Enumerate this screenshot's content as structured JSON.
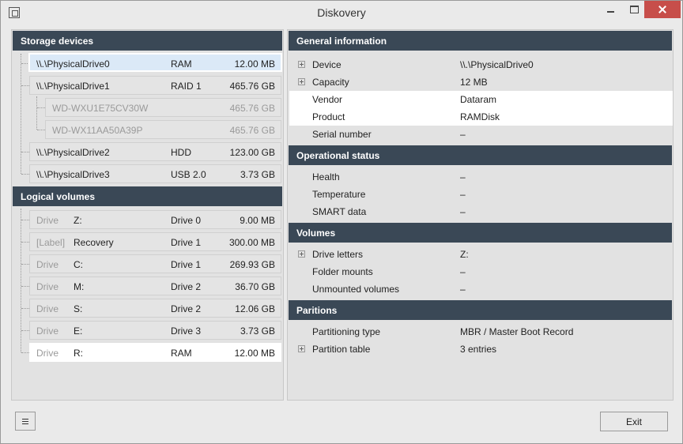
{
  "window": {
    "title": "Diskovery"
  },
  "storage": {
    "header": "Storage devices",
    "devices": [
      {
        "name": "\\\\.\\PhysicalDrive0",
        "type": "RAM",
        "size": "12.00 MB"
      },
      {
        "name": "\\\\.\\PhysicalDrive1",
        "type": "RAID 1",
        "size": "465.76 GB"
      },
      {
        "name": "WD-WXU1E75CV30W",
        "type": "",
        "size": "465.76 GB"
      },
      {
        "name": "WD-WX11AA50A39P",
        "type": "",
        "size": "465.76 GB"
      },
      {
        "name": "\\\\.\\PhysicalDrive2",
        "type": "HDD",
        "size": "123.00 GB"
      },
      {
        "name": "\\\\.\\PhysicalDrive3",
        "type": "USB 2.0",
        "size": "3.73 GB"
      }
    ]
  },
  "volumes": {
    "header": "Logical volumes",
    "items": [
      {
        "kind": "Drive",
        "name": "Z:",
        "drive": "Drive 0",
        "size": "9.00 MB"
      },
      {
        "kind": "[Label]",
        "name": "Recovery",
        "drive": "Drive 1",
        "size": "300.00 MB"
      },
      {
        "kind": "Drive",
        "name": "C:",
        "drive": "Drive 1",
        "size": "269.93 GB"
      },
      {
        "kind": "Drive",
        "name": "M:",
        "drive": "Drive 2",
        "size": "36.70 GB"
      },
      {
        "kind": "Drive",
        "name": "S:",
        "drive": "Drive 2",
        "size": "12.06 GB"
      },
      {
        "kind": "Drive",
        "name": "E:",
        "drive": "Drive 3",
        "size": "3.73 GB"
      },
      {
        "kind": "Drive",
        "name": "R:",
        "drive": "RAM",
        "size": "12.00 MB"
      }
    ]
  },
  "general": {
    "header": "General information",
    "rows": [
      {
        "label": "Device",
        "value": "\\\\.\\PhysicalDrive0"
      },
      {
        "label": "Capacity",
        "value": "12 MB"
      },
      {
        "label": "Vendor",
        "value": "Dataram"
      },
      {
        "label": "Product",
        "value": "RAMDisk"
      },
      {
        "label": "Serial number",
        "value": "–"
      }
    ]
  },
  "operational": {
    "header": "Operational status",
    "rows": [
      {
        "label": "Health",
        "value": "–"
      },
      {
        "label": "Temperature",
        "value": "–"
      },
      {
        "label": "SMART data",
        "value": "–"
      }
    ]
  },
  "volumes_info": {
    "header": "Volumes",
    "rows": [
      {
        "label": "Drive letters",
        "value": "Z:"
      },
      {
        "label": "Folder mounts",
        "value": "–"
      },
      {
        "label": "Unmounted volumes",
        "value": "–"
      }
    ]
  },
  "partitions": {
    "header": "Paritions",
    "rows": [
      {
        "label": "Partitioning type",
        "value": "MBR / Master Boot Record"
      },
      {
        "label": "Partition table",
        "value": "3 entries"
      }
    ]
  },
  "footer": {
    "exit_label": "Exit"
  }
}
